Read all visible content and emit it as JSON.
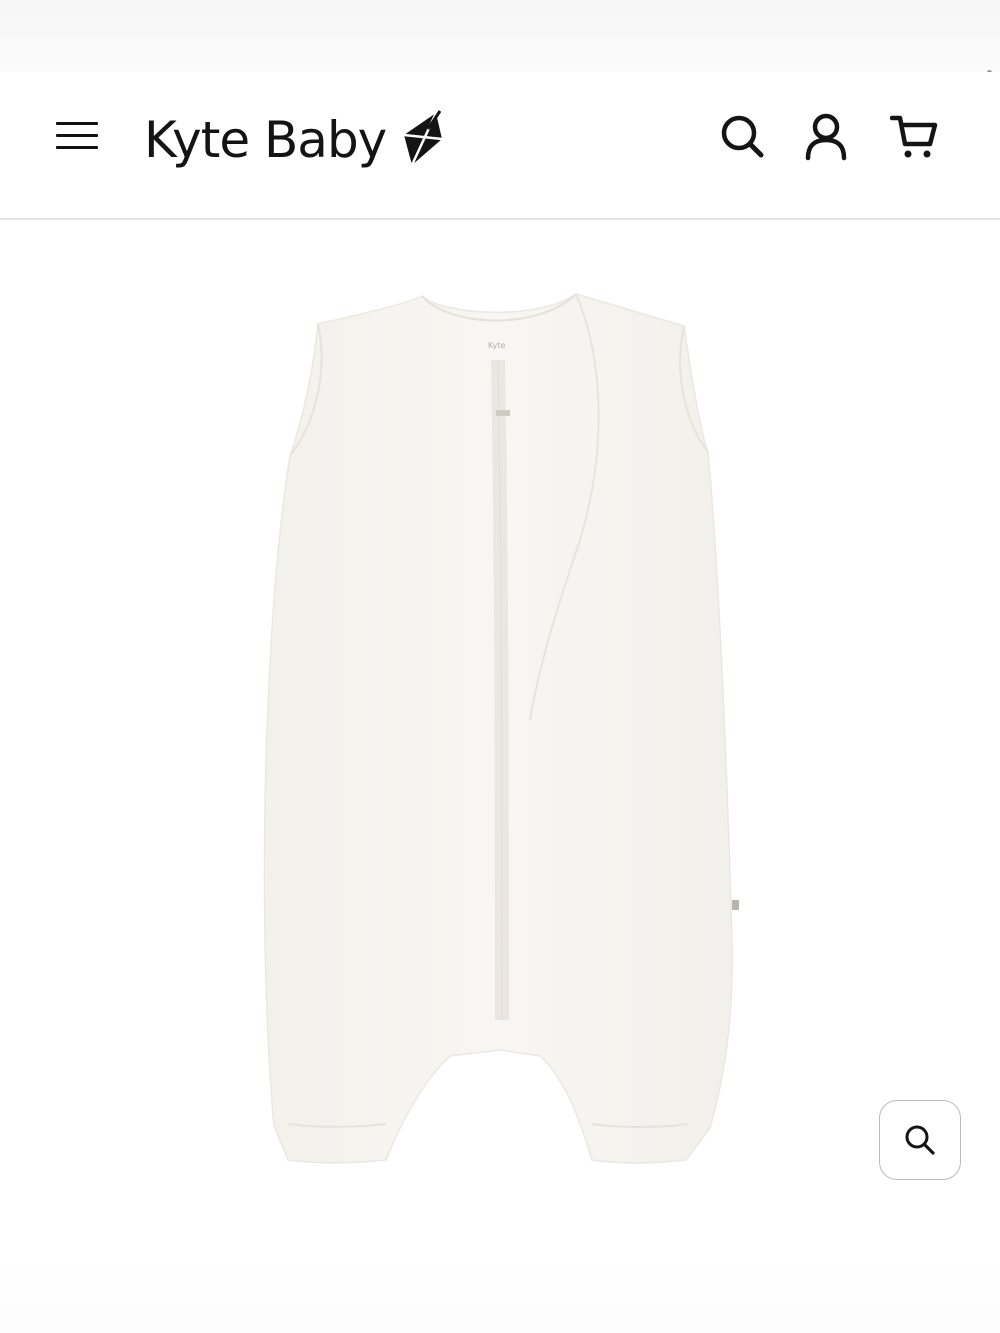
{
  "header": {
    "logo_text": "Kyte Baby",
    "icons": {
      "menu": "hamburger-menu-icon",
      "search": "search-icon",
      "account": "user-icon",
      "cart": "cart-icon",
      "brand": "kite-logo-icon"
    }
  },
  "product": {
    "image_label": "",
    "image_tag_text": "Kyte"
  },
  "zoom": {
    "icon": "zoom-search-icon"
  },
  "colors": {
    "text": "#141414",
    "garment": "#f7f5f1",
    "border": "#bdbdbd"
  }
}
